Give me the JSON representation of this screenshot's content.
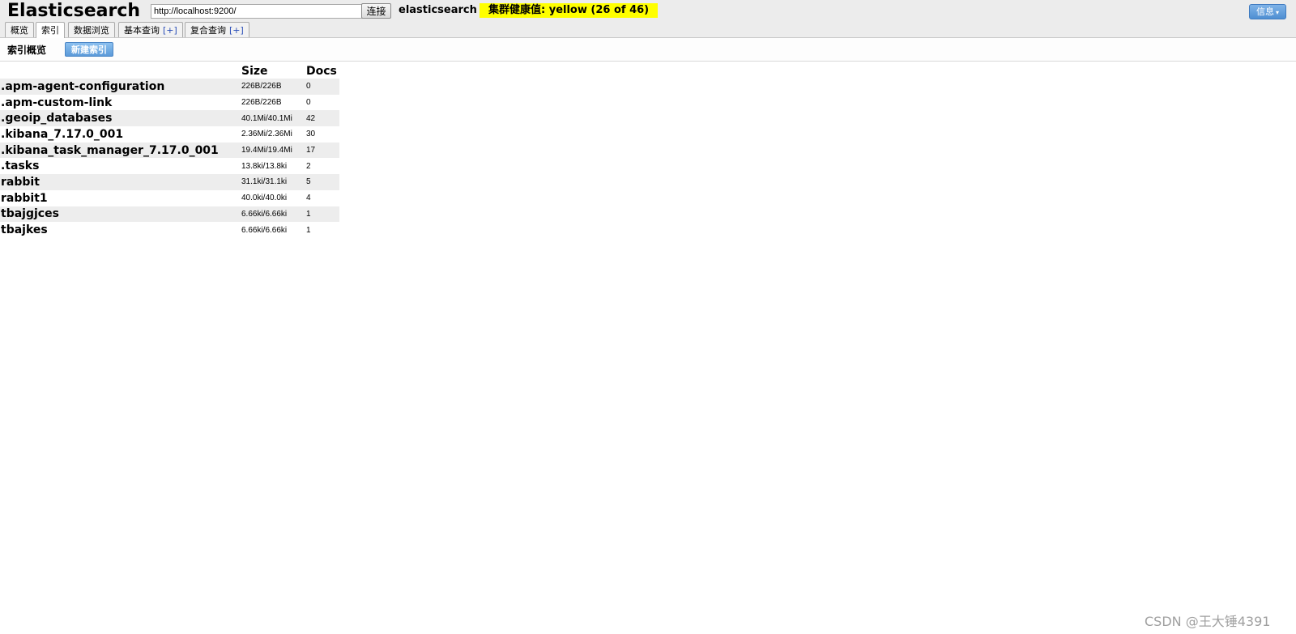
{
  "header": {
    "title": "Elasticsearch",
    "url_value": "http://localhost:9200/",
    "connect_label": "连接",
    "cluster_name": "elasticsearch",
    "health_text": "集群健康值: yellow (26 of 46)",
    "health_color": "#ffff00",
    "info_label": "信息",
    "info_caret": "▾"
  },
  "tabs": [
    {
      "label": "概览",
      "plus": ""
    },
    {
      "label": "索引",
      "plus": "",
      "active": true
    },
    {
      "label": "数据浏览",
      "plus": ""
    },
    {
      "label": "基本查询",
      "plus": "[+]"
    },
    {
      "label": "复合查询",
      "plus": "[+]"
    }
  ],
  "toolbar": {
    "title": "索引概览",
    "new_index_label": "新建索引"
  },
  "table": {
    "headers": [
      "",
      "Size",
      "Docs"
    ],
    "rows": [
      {
        "name": ".apm-agent-configuration",
        "size": "226B/226B",
        "docs": "0"
      },
      {
        "name": ".apm-custom-link",
        "size": "226B/226B",
        "docs": "0"
      },
      {
        "name": ".geoip_databases",
        "size": "40.1Mi/40.1Mi",
        "docs": "42"
      },
      {
        "name": ".kibana_7.17.0_001",
        "size": "2.36Mi/2.36Mi",
        "docs": "30"
      },
      {
        "name": ".kibana_task_manager_7.17.0_001",
        "size": "19.4Mi/19.4Mi",
        "docs": "17"
      },
      {
        "name": ".tasks",
        "size": "13.8ki/13.8ki",
        "docs": "2"
      },
      {
        "name": "rabbit",
        "size": "31.1ki/31.1ki",
        "docs": "5"
      },
      {
        "name": "rabbit1",
        "size": "40.0ki/40.0ki",
        "docs": "4"
      },
      {
        "name": "tbajgjces",
        "size": "6.66ki/6.66ki",
        "docs": "1"
      },
      {
        "name": "tbajkes",
        "size": "6.66ki/6.66ki",
        "docs": "1"
      }
    ]
  },
  "watermark": "CSDN @王大锤4391"
}
